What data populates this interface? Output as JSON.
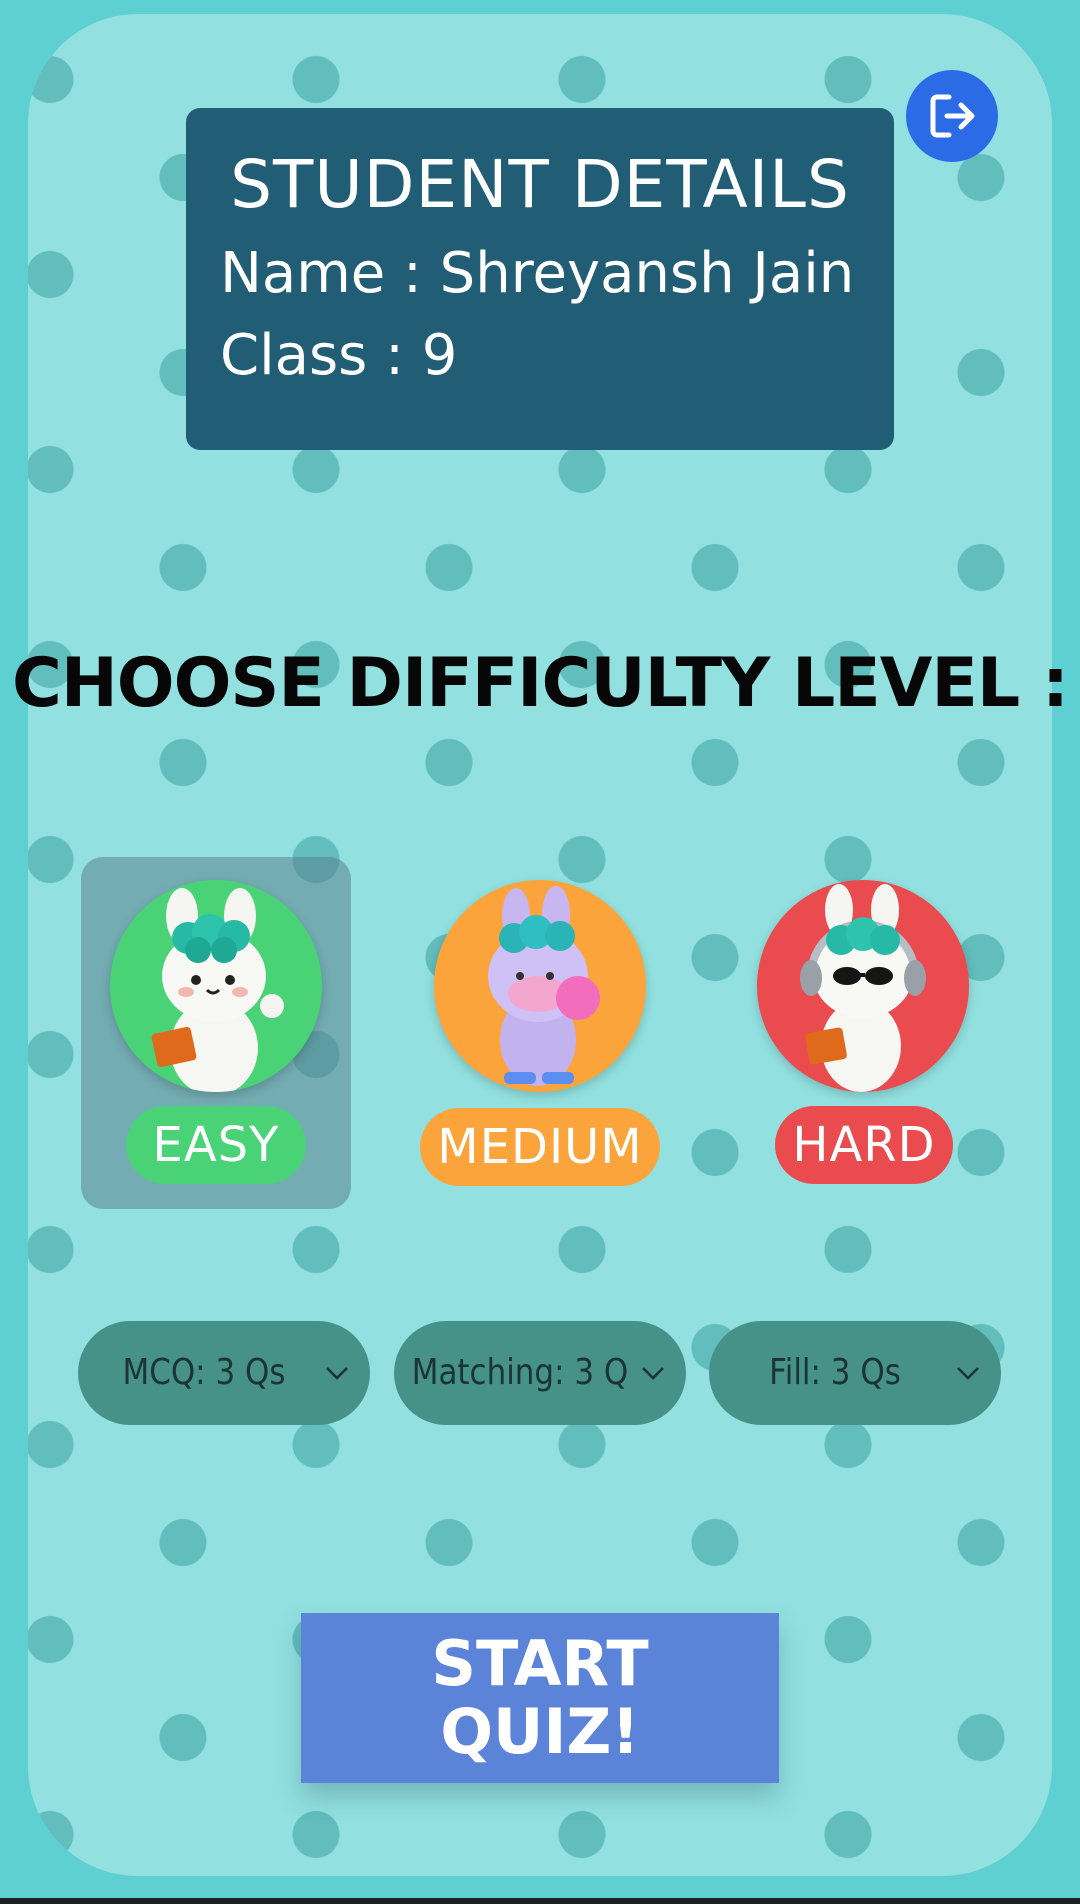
{
  "student": {
    "title": "STUDENT DETAILS",
    "name_line": "Name : Shreyansh Jain",
    "class_line": "Class : 9"
  },
  "logout": {
    "icon": "logout-icon"
  },
  "difficulty": {
    "heading": "CHOOSE DIFFICULTY LEVEL :",
    "selected": "EASY",
    "levels": [
      {
        "label": "EASY",
        "color": "#4ad277"
      },
      {
        "label": "MEDIUM",
        "color": "#fca43c"
      },
      {
        "label": "HARD",
        "color": "#e94b4e"
      }
    ]
  },
  "question_selects": {
    "mcq": "MCQ: 3 Qs",
    "matching": "Matching: 3 Q",
    "fill": "Fill: 3 Qs"
  },
  "start_button": {
    "line1": "START",
    "line2": "QUIZ!"
  },
  "colors": {
    "background": "#5fd0d1",
    "card": "#92e1e0",
    "student_box": "#215e76",
    "select": "#469289",
    "start": "#5b84d8",
    "logout": "#2c6be6"
  }
}
